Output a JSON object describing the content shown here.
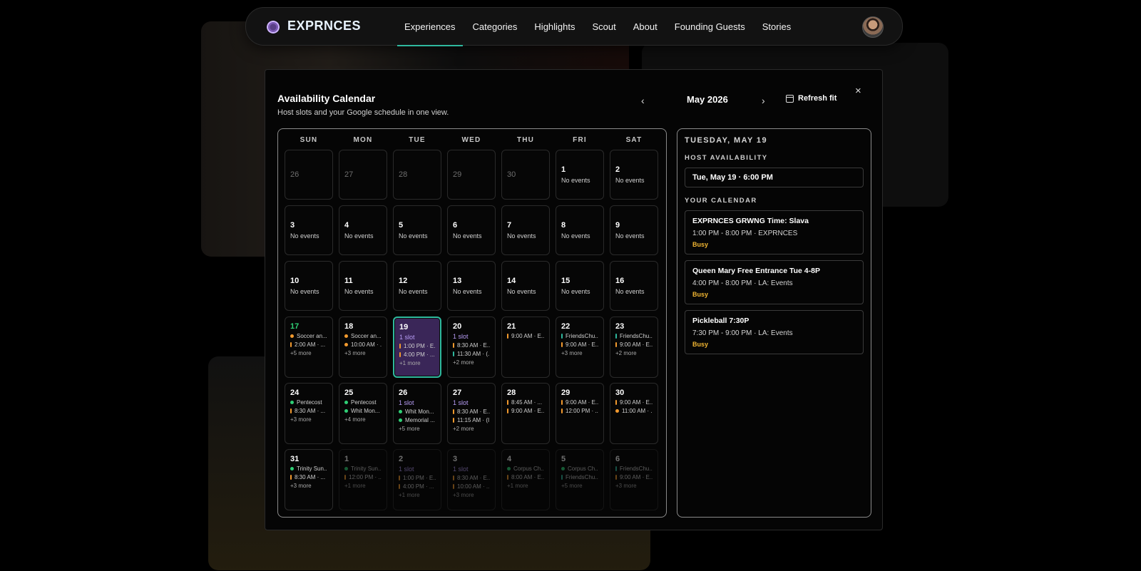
{
  "brand": "EXPRNCES",
  "nav": [
    "Experiences",
    "Categories",
    "Highlights",
    "Scout",
    "About",
    "Founding Guests",
    "Stories"
  ],
  "modal": {
    "title": "Availability Calendar",
    "subtitle": "Host slots and your Google schedule in one view.",
    "prev_icon": "‹",
    "month": "May 2026",
    "next_icon": "›",
    "refresh_label": "Refresh fit",
    "close_icon": "×"
  },
  "weekdays": [
    "SUN",
    "MON",
    "TUE",
    "WED",
    "THU",
    "FRI",
    "SAT"
  ],
  "weeks": [
    [
      {
        "n": "26",
        "kind": "dim"
      },
      {
        "n": "27",
        "kind": "dim"
      },
      {
        "n": "28",
        "kind": "dim"
      },
      {
        "n": "29",
        "kind": "dim"
      },
      {
        "n": "30",
        "kind": "dim"
      },
      {
        "n": "1",
        "note": "No events"
      },
      {
        "n": "2",
        "note": "No events"
      }
    ],
    [
      {
        "n": "3",
        "note": "No events"
      },
      {
        "n": "4",
        "note": "No events"
      },
      {
        "n": "5",
        "note": "No events"
      },
      {
        "n": "6",
        "note": "No events"
      },
      {
        "n": "7",
        "note": "No events"
      },
      {
        "n": "8",
        "note": "No events"
      },
      {
        "n": "9",
        "note": "No events"
      }
    ],
    [
      {
        "n": "10",
        "note": "No events"
      },
      {
        "n": "11",
        "note": "No events"
      },
      {
        "n": "12",
        "note": "No events"
      },
      {
        "n": "13",
        "note": "No events"
      },
      {
        "n": "14",
        "note": "No events"
      },
      {
        "n": "15",
        "note": "No events"
      },
      {
        "n": "16",
        "note": "No events"
      }
    ],
    [
      {
        "n": "17",
        "kind": "today",
        "events": [
          {
            "m": "dot-o",
            "t": "Soccer an..."
          },
          {
            "m": "bar-o",
            "t": "2:00 AM · ..."
          }
        ],
        "more": "+5 more"
      },
      {
        "n": "18",
        "events": [
          {
            "m": "dot-o",
            "t": "Soccer an..."
          },
          {
            "m": "dot-o",
            "t": "10:00 AM · ..."
          }
        ],
        "more": "+3 more"
      },
      {
        "n": "19",
        "kind": "selected",
        "slot": "1 slot",
        "events": [
          {
            "m": "bar-o",
            "t": "1:00 PM · E..."
          },
          {
            "m": "bar-o",
            "t": "4:00 PM · ..."
          }
        ],
        "more": "+1 more"
      },
      {
        "n": "20",
        "slot": "1 slot",
        "events": [
          {
            "m": "bar-o",
            "t": "8:30 AM · E..."
          },
          {
            "m": "bar-t",
            "t": "11:30 AM · (..."
          }
        ],
        "more": "+2 more"
      },
      {
        "n": "21",
        "events": [
          {
            "m": "bar-o",
            "t": "9:00 AM · E..."
          }
        ]
      },
      {
        "n": "22",
        "events": [
          {
            "m": "bar-t",
            "t": "FriendsChu..."
          },
          {
            "m": "bar-o",
            "t": "9:00 AM · E..."
          }
        ],
        "more": "+3 more"
      },
      {
        "n": "23",
        "events": [
          {
            "m": "bar-t",
            "t": "FriendsChu..."
          },
          {
            "m": "bar-o",
            "t": "9:00 AM · E..."
          }
        ],
        "more": "+2 more"
      }
    ],
    [
      {
        "n": "24",
        "events": [
          {
            "m": "dot-g",
            "t": "Pentecost"
          },
          {
            "m": "bar-o",
            "t": "8:30 AM · ..."
          }
        ],
        "more": "+3 more"
      },
      {
        "n": "25",
        "events": [
          {
            "m": "dot-g",
            "t": "Pentecost"
          },
          {
            "m": "dot-g",
            "t": "Whit Mon..."
          }
        ],
        "more": "+4 more"
      },
      {
        "n": "26",
        "slot": "1 slot",
        "events": [
          {
            "m": "dot-g",
            "t": "Whit Mon..."
          },
          {
            "m": "dot-g",
            "t": "Memorial ..."
          }
        ],
        "more": "+5 more"
      },
      {
        "n": "27",
        "slot": "1 slot",
        "events": [
          {
            "m": "bar-o",
            "t": "8:30 AM · E..."
          },
          {
            "m": "bar-o",
            "t": "11:15 AM · (I..."
          }
        ],
        "more": "+2 more"
      },
      {
        "n": "28",
        "events": [
          {
            "m": "bar-o",
            "t": "8:45 AM · ..."
          },
          {
            "m": "bar-o",
            "t": "9:00 AM · E..."
          }
        ]
      },
      {
        "n": "29",
        "events": [
          {
            "m": "bar-o",
            "t": "9:00 AM · E..."
          },
          {
            "m": "bar-o",
            "t": "12:00 PM · ..."
          }
        ]
      },
      {
        "n": "30",
        "events": [
          {
            "m": "bar-o",
            "t": "9:00 AM · E..."
          },
          {
            "m": "dot-o",
            "t": "11:00 AM · ..."
          }
        ]
      }
    ],
    [
      {
        "n": "31",
        "events": [
          {
            "m": "dot-g",
            "t": "Trinity Sun..."
          },
          {
            "m": "bar-o",
            "t": "8:30 AM · ..."
          }
        ],
        "more": "+3 more"
      },
      {
        "n": "1",
        "kind": "faded",
        "events": [
          {
            "m": "dot-g",
            "t": "Trinity Sun..."
          },
          {
            "m": "bar-o",
            "t": "12:00 PM · ..."
          }
        ],
        "more": "+1 more"
      },
      {
        "n": "2",
        "kind": "faded",
        "slot": "1 slot",
        "events": [
          {
            "m": "bar-o",
            "t": "1:00 PM · E..."
          },
          {
            "m": "bar-o",
            "t": "4:00 PM · ..."
          }
        ],
        "more": "+1 more"
      },
      {
        "n": "3",
        "kind": "faded",
        "slot": "1 slot",
        "events": [
          {
            "m": "bar-o",
            "t": "8:30 AM · E..."
          },
          {
            "m": "bar-o",
            "t": "10:00 AM · ..."
          }
        ],
        "more": "+3 more"
      },
      {
        "n": "4",
        "kind": "faded",
        "events": [
          {
            "m": "dot-g",
            "t": "Corpus Ch..."
          },
          {
            "m": "bar-o",
            "t": "8:00 AM · E..."
          }
        ],
        "more": "+1 more"
      },
      {
        "n": "5",
        "kind": "faded",
        "events": [
          {
            "m": "dot-g",
            "t": "Corpus Ch..."
          },
          {
            "m": "bar-t",
            "t": "FriendsChu..."
          }
        ],
        "more": "+5 more"
      },
      {
        "n": "6",
        "kind": "faded",
        "events": [
          {
            "m": "bar-t",
            "t": "FriendsChu..."
          },
          {
            "m": "bar-o",
            "t": "9:00 AM · E..."
          }
        ],
        "more": "+3 more"
      }
    ]
  ],
  "detail": {
    "date": "TUESDAY, MAY 19",
    "host_heading": "HOST AVAILABILITY",
    "host_slot": "Tue, May 19 · 6:00 PM",
    "cal_heading": "YOUR CALENDAR",
    "events": [
      {
        "title": "EXPRNCES GRWNG Time: Slava",
        "meta": "1:00 PM - 8:00 PM · EXPRNCES",
        "status": "Busy"
      },
      {
        "title": "Queen Mary Free Entrance Tue 4-8P",
        "meta": "4:00 PM - 8:00 PM · LA: Events",
        "status": "Busy"
      },
      {
        "title": "Pickleball 7:30P",
        "meta": "7:30 PM - 9:00 PM · LA: Events",
        "status": "Busy"
      }
    ]
  },
  "colors": {
    "accent_teal": "#2fb89e",
    "slot_purple": "#b79cf5",
    "busy_amber": "#f2b632",
    "event_orange": "#f29a2e",
    "holiday_green": "#2fcf75",
    "selected_bg": "#3a2658"
  }
}
